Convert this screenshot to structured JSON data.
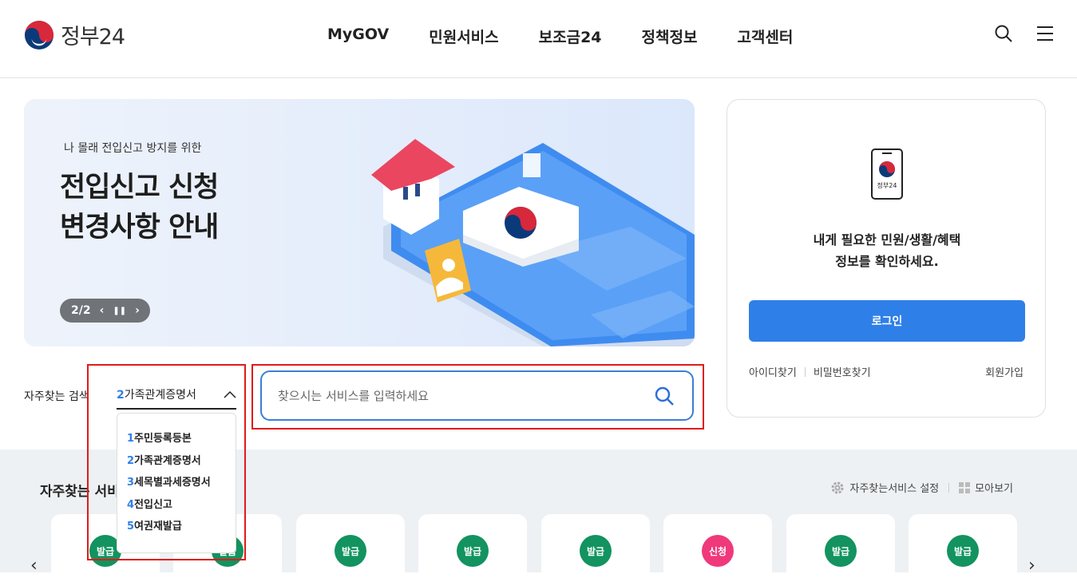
{
  "header": {
    "logo_text": "정부24",
    "nav": [
      "MyGOV",
      "민원서비스",
      "보조금24",
      "정책정보",
      "고객센터"
    ]
  },
  "banner": {
    "subtitle": "나 몰래 전입신고 방지를 위한",
    "title_line1": "전입신고 신청",
    "title_line2": "변경사항 안내",
    "page": "2/2"
  },
  "login": {
    "phone_label": "정부24",
    "message_line1": "내게 필요한 민원/생활/혜택",
    "message_line2": "정보를 확인하세요.",
    "button": "로그인",
    "find_id": "아이디찾기",
    "find_pw": "비밀번호찾기",
    "signup": "회원가입"
  },
  "favorites": {
    "label": "자주찾는 검색",
    "selected_num": "2",
    "selected_text": "가족관계증명서",
    "items": [
      {
        "num": "1",
        "text": "주민등록등본"
      },
      {
        "num": "2",
        "text": "가족관계증명서"
      },
      {
        "num": "3",
        "text": "세목별과세증명서"
      },
      {
        "num": "4",
        "text": "전입신고"
      },
      {
        "num": "5",
        "text": "여권재발급"
      }
    ]
  },
  "search": {
    "placeholder": "찾으시는 서비스를 입력하세요"
  },
  "services": {
    "title": "자주찾는 서비",
    "settings": "자주찾는서비스 설정",
    "view_all": "모아보기",
    "cards": [
      {
        "badge": "발급",
        "color": "#12935f"
      },
      {
        "badge": "발급",
        "color": "#12935f"
      },
      {
        "badge": "발급",
        "color": "#12935f"
      },
      {
        "badge": "발급",
        "color": "#12935f"
      },
      {
        "badge": "발급",
        "color": "#12935f"
      },
      {
        "badge": "신청",
        "color": "#f0397a"
      },
      {
        "badge": "발급",
        "color": "#12935f"
      },
      {
        "badge": "발급",
        "color": "#12935f"
      }
    ]
  }
}
